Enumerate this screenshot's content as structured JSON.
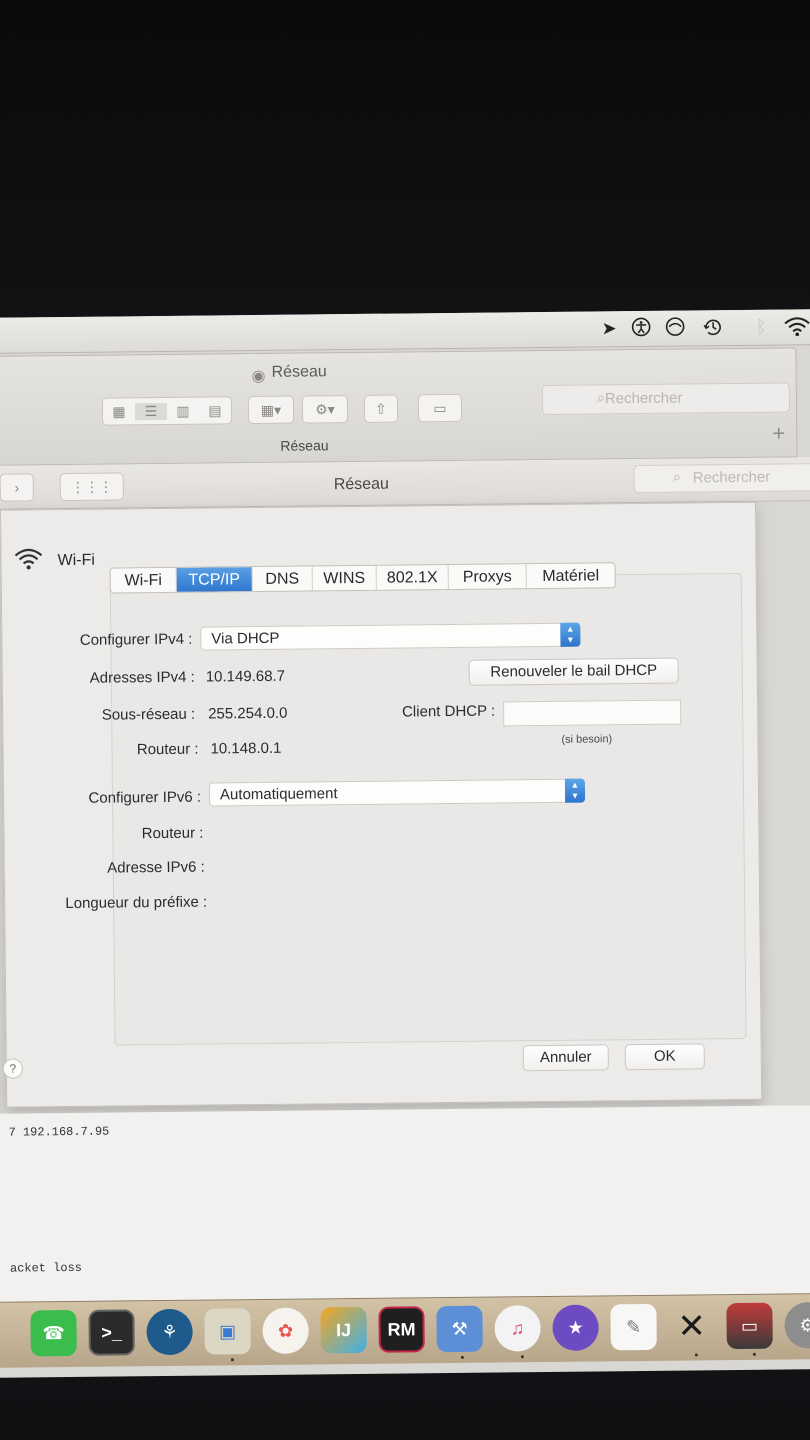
{
  "menubar": {
    "icons": [
      "location-arrow-icon",
      "accessibility-icon",
      "do-not-disturb-icon",
      "time-machine-icon",
      "bluetooth-icon",
      "wifi-icon"
    ]
  },
  "background_window": {
    "title": "Réseau",
    "subtitle": "Réseau",
    "search_placeholder": "Rechercher"
  },
  "network_window": {
    "title": "Réseau",
    "search_placeholder": "Rechercher"
  },
  "sheet": {
    "interface_name": "Wi-Fi",
    "tabs": [
      {
        "label": "Wi-Fi",
        "active": false
      },
      {
        "label": "TCP/IP",
        "active": true
      },
      {
        "label": "DNS",
        "active": false
      },
      {
        "label": "WINS",
        "active": false
      },
      {
        "label": "802.1X",
        "active": false
      },
      {
        "label": "Proxys",
        "active": false
      },
      {
        "label": "Matériel",
        "active": false
      }
    ],
    "ipv4": {
      "configure_label": "Configurer IPv4 :",
      "configure_value": "Via DHCP",
      "address_label": "Adresses IPv4 :",
      "address_value": "10.149.68.7",
      "renew_button": "Renouveler le bail DHCP",
      "subnet_label": "Sous-réseau :",
      "subnet_value": "255.254.0.0",
      "dhcp_client_label": "Client DHCP :",
      "dhcp_client_value": "",
      "dhcp_client_hint": "(si besoin)",
      "router_label": "Routeur :",
      "router_value": "10.148.0.1"
    },
    "ipv6": {
      "configure_label": "Configurer IPv6 :",
      "configure_value": "Automatiquement",
      "router_label": "Routeur :",
      "address_label": "Adresse IPv6 :",
      "prefix_label": "Longueur du préfixe :"
    },
    "help_label": "?",
    "cancel_button": "Annuler",
    "ok_button": "OK"
  },
  "terminal": {
    "line1": "7  192.168.7.95",
    "line2": "acket loss"
  },
  "dock": {
    "items": [
      "facetime-icon",
      "terminal-icon",
      "sourcetree-icon",
      "preview-icon",
      "photos-icon",
      "intellij-icon",
      "rubymine-icon",
      "xcode-icon",
      "itunes-icon",
      "imovie-icon",
      "textedit-icon",
      "x11-icon",
      "screenshot-icon",
      "system-preferences-icon"
    ],
    "rubymine_label": "RM"
  },
  "colors": {
    "accent_blue": "#2f77cf",
    "window_bg": "#ecebe9"
  }
}
